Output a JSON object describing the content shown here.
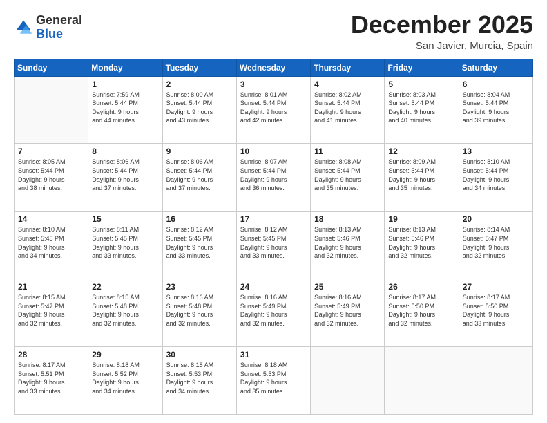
{
  "logo": {
    "general": "General",
    "blue": "Blue"
  },
  "header": {
    "month": "December 2025",
    "location": "San Javier, Murcia, Spain"
  },
  "days_of_week": [
    "Sunday",
    "Monday",
    "Tuesday",
    "Wednesday",
    "Thursday",
    "Friday",
    "Saturday"
  ],
  "weeks": [
    [
      {
        "num": "",
        "info": ""
      },
      {
        "num": "1",
        "info": "Sunrise: 7:59 AM\nSunset: 5:44 PM\nDaylight: 9 hours\nand 44 minutes."
      },
      {
        "num": "2",
        "info": "Sunrise: 8:00 AM\nSunset: 5:44 PM\nDaylight: 9 hours\nand 43 minutes."
      },
      {
        "num": "3",
        "info": "Sunrise: 8:01 AM\nSunset: 5:44 PM\nDaylight: 9 hours\nand 42 minutes."
      },
      {
        "num": "4",
        "info": "Sunrise: 8:02 AM\nSunset: 5:44 PM\nDaylight: 9 hours\nand 41 minutes."
      },
      {
        "num": "5",
        "info": "Sunrise: 8:03 AM\nSunset: 5:44 PM\nDaylight: 9 hours\nand 40 minutes."
      },
      {
        "num": "6",
        "info": "Sunrise: 8:04 AM\nSunset: 5:44 PM\nDaylight: 9 hours\nand 39 minutes."
      }
    ],
    [
      {
        "num": "7",
        "info": "Sunrise: 8:05 AM\nSunset: 5:44 PM\nDaylight: 9 hours\nand 38 minutes."
      },
      {
        "num": "8",
        "info": "Sunrise: 8:06 AM\nSunset: 5:44 PM\nDaylight: 9 hours\nand 37 minutes."
      },
      {
        "num": "9",
        "info": "Sunrise: 8:06 AM\nSunset: 5:44 PM\nDaylight: 9 hours\nand 37 minutes."
      },
      {
        "num": "10",
        "info": "Sunrise: 8:07 AM\nSunset: 5:44 PM\nDaylight: 9 hours\nand 36 minutes."
      },
      {
        "num": "11",
        "info": "Sunrise: 8:08 AM\nSunset: 5:44 PM\nDaylight: 9 hours\nand 35 minutes."
      },
      {
        "num": "12",
        "info": "Sunrise: 8:09 AM\nSunset: 5:44 PM\nDaylight: 9 hours\nand 35 minutes."
      },
      {
        "num": "13",
        "info": "Sunrise: 8:10 AM\nSunset: 5:44 PM\nDaylight: 9 hours\nand 34 minutes."
      }
    ],
    [
      {
        "num": "14",
        "info": "Sunrise: 8:10 AM\nSunset: 5:45 PM\nDaylight: 9 hours\nand 34 minutes."
      },
      {
        "num": "15",
        "info": "Sunrise: 8:11 AM\nSunset: 5:45 PM\nDaylight: 9 hours\nand 33 minutes."
      },
      {
        "num": "16",
        "info": "Sunrise: 8:12 AM\nSunset: 5:45 PM\nDaylight: 9 hours\nand 33 minutes."
      },
      {
        "num": "17",
        "info": "Sunrise: 8:12 AM\nSunset: 5:45 PM\nDaylight: 9 hours\nand 33 minutes."
      },
      {
        "num": "18",
        "info": "Sunrise: 8:13 AM\nSunset: 5:46 PM\nDaylight: 9 hours\nand 32 minutes."
      },
      {
        "num": "19",
        "info": "Sunrise: 8:13 AM\nSunset: 5:46 PM\nDaylight: 9 hours\nand 32 minutes."
      },
      {
        "num": "20",
        "info": "Sunrise: 8:14 AM\nSunset: 5:47 PM\nDaylight: 9 hours\nand 32 minutes."
      }
    ],
    [
      {
        "num": "21",
        "info": "Sunrise: 8:15 AM\nSunset: 5:47 PM\nDaylight: 9 hours\nand 32 minutes."
      },
      {
        "num": "22",
        "info": "Sunrise: 8:15 AM\nSunset: 5:48 PM\nDaylight: 9 hours\nand 32 minutes."
      },
      {
        "num": "23",
        "info": "Sunrise: 8:16 AM\nSunset: 5:48 PM\nDaylight: 9 hours\nand 32 minutes."
      },
      {
        "num": "24",
        "info": "Sunrise: 8:16 AM\nSunset: 5:49 PM\nDaylight: 9 hours\nand 32 minutes."
      },
      {
        "num": "25",
        "info": "Sunrise: 8:16 AM\nSunset: 5:49 PM\nDaylight: 9 hours\nand 32 minutes."
      },
      {
        "num": "26",
        "info": "Sunrise: 8:17 AM\nSunset: 5:50 PM\nDaylight: 9 hours\nand 32 minutes."
      },
      {
        "num": "27",
        "info": "Sunrise: 8:17 AM\nSunset: 5:50 PM\nDaylight: 9 hours\nand 33 minutes."
      }
    ],
    [
      {
        "num": "28",
        "info": "Sunrise: 8:17 AM\nSunset: 5:51 PM\nDaylight: 9 hours\nand 33 minutes."
      },
      {
        "num": "29",
        "info": "Sunrise: 8:18 AM\nSunset: 5:52 PM\nDaylight: 9 hours\nand 34 minutes."
      },
      {
        "num": "30",
        "info": "Sunrise: 8:18 AM\nSunset: 5:53 PM\nDaylight: 9 hours\nand 34 minutes."
      },
      {
        "num": "31",
        "info": "Sunrise: 8:18 AM\nSunset: 5:53 PM\nDaylight: 9 hours\nand 35 minutes."
      },
      {
        "num": "",
        "info": ""
      },
      {
        "num": "",
        "info": ""
      },
      {
        "num": "",
        "info": ""
      }
    ]
  ]
}
